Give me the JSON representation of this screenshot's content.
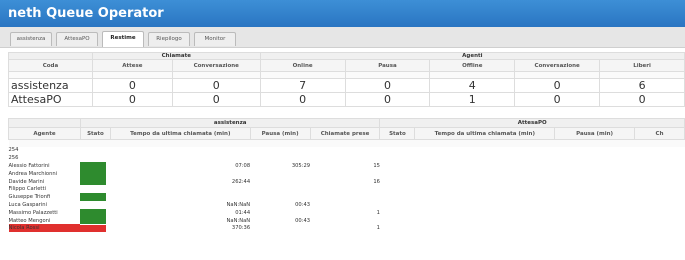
{
  "app": {
    "title": "neth Queue Operator"
  },
  "tabs": [
    {
      "label": "assistenza"
    },
    {
      "label": "AttesaPO"
    },
    {
      "label": "Restime",
      "active": true
    },
    {
      "label": "Riepilogo"
    },
    {
      "label": "Monitor"
    }
  ],
  "summary": {
    "groups": {
      "chiamate": "Chiamate",
      "agenti": "Agenti"
    },
    "columns": [
      "Coda",
      "Attese",
      "Conversazione",
      "Online",
      "Pausa",
      "Offline",
      "Conversazione",
      "Liberi"
    ],
    "rows": [
      {
        "coda": "assistenza",
        "values": [
          "0",
          "0",
          "7",
          "0",
          "4",
          "0",
          "6"
        ]
      },
      {
        "coda": "AttesaPO",
        "values": [
          "0",
          "0",
          "0",
          "0",
          "1",
          "0",
          "0"
        ]
      }
    ]
  },
  "agents": {
    "group1": "assistenza",
    "group2": "AttesaPO",
    "columns": [
      "Agente",
      "Stato",
      "Tempo da ultima chiamata (min)",
      "Pausa (min)",
      "Chiamate prese",
      "Stato",
      "Tempo da ultima chiamata (min)",
      "Pausa (min)",
      "Ch"
    ],
    "rows": [
      {
        "name": "254"
      },
      {
        "name": "256"
      },
      {
        "name": "Alessio Fattorini",
        "status": "green",
        "time": "07:08",
        "pause": "305:29",
        "calls": "15"
      },
      {
        "name": "Andrea Marchionni",
        "status": "green"
      },
      {
        "name": "Davide Marini",
        "status": "green",
        "time": "262:44",
        "calls": "16"
      },
      {
        "name": "Filippo Carletti"
      },
      {
        "name": "Giuseppe Trionfi",
        "status": "green"
      },
      {
        "name": "Luca Gasparini",
        "time": "NaN:NaN",
        "pause": "00:43"
      },
      {
        "name": "Massimo Palazzetti",
        "status": "green",
        "time": "01:44",
        "calls": "1"
      },
      {
        "name": "Matteo Mengoni",
        "status": "green",
        "time": "NaN:NaN",
        "pause": "00:43"
      },
      {
        "name": "Nicola Rossi",
        "status": "red",
        "time": "370:36",
        "calls": "1"
      }
    ]
  },
  "colors": {
    "title_bar": "#2a75c2",
    "status_green": "#2e8b2e",
    "status_red": "#e0302e"
  }
}
